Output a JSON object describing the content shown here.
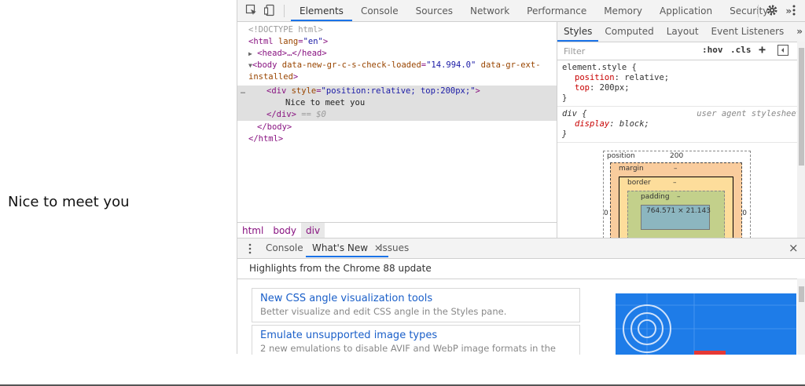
{
  "page": {
    "text": "Nice to meet you"
  },
  "devtools": {
    "tabs": [
      "Elements",
      "Console",
      "Sources",
      "Network",
      "Performance",
      "Memory",
      "Application",
      "Security"
    ],
    "overflow": "»",
    "elements": {
      "doctype": "<!DOCTYPE html>",
      "html_open": "<html",
      "html_attr": "lang",
      "html_val": "\"en\"",
      "head": "<head>…</head>",
      "body_attr1": "data-new-gr-c-s-check-loaded",
      "body_val1": "\"14.994.0\"",
      "body_attr2": "data-gr-ext-",
      "body_attr2_cont": "installed",
      "div_attr": "style",
      "div_val": "\"position:relative; top:200px;\"",
      "div_text": "Nice to meet you",
      "div_close": "</div>",
      "selected_marker": "== $0",
      "ellipsis": "…",
      "body_close": "</body>",
      "html_close": "</html>"
    },
    "breadcrumb": [
      "html",
      "body",
      "div"
    ],
    "styles": {
      "subtabs": [
        "Styles",
        "Computed",
        "Layout",
        "Event Listeners"
      ],
      "overflow": "»",
      "filter_placeholder": "Filter",
      "hov": ":hov",
      "cls": ".cls",
      "plus": "+",
      "element_selector": "element.style {",
      "rule1_prop1": "position",
      "rule1_val1": "relative;",
      "rule1_prop2": "top",
      "rule1_val2": "200px;",
      "close_brace": "}",
      "div_selector": "div {",
      "ua_source": "user agent stylesheet",
      "div_prop": "display",
      "div_val": "block;",
      "boxmodel": {
        "position_label": "position",
        "position_value": "200",
        "margin_label": "margin",
        "margin_value": "–",
        "border_label": "border",
        "border_value": "–",
        "padding_label": "padding",
        "padding_value": "–",
        "side_value": "0",
        "content_size": "764.571 × 21.143"
      }
    },
    "drawer": {
      "tabs": [
        "Console",
        "What's New",
        "Issues"
      ],
      "close_tab": "×",
      "close_drawer": "×",
      "highlights": "Highlights from the Chrome 88 update",
      "cards": [
        {
          "title": "New CSS angle visualization tools",
          "desc": "Better visualize and edit CSS angle in the Styles pane."
        },
        {
          "title": "Emulate unsupported image types",
          "desc": "2 new emulations to disable AVIF and WebP image formats in the"
        }
      ]
    },
    "colors": {
      "accent": "#1a73e8",
      "tag": "#881280",
      "attr": "#994500",
      "value": "#1a1aa6",
      "prop": "#c80000"
    }
  }
}
